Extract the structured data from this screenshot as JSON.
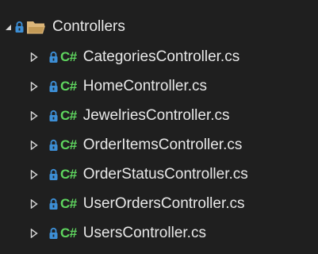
{
  "colors": {
    "background": "#1f1f1f",
    "text": "#e8e8e8",
    "lock_accent": "#3d8fd6",
    "folder_yellow": "#dcb67a",
    "csharp_green": "#5fd65f",
    "expander": "#d4d4d4"
  },
  "folder": {
    "icon": "lock-icon",
    "folder_icon": "folder-open-icon",
    "expander_icon": "expanded-triangle-icon",
    "label": "Controllers"
  },
  "files": [
    {
      "label": "CategoriesController.cs",
      "badge": "C#"
    },
    {
      "label": "HomeController.cs",
      "badge": "C#"
    },
    {
      "label": "JewelriesController.cs",
      "badge": "C#"
    },
    {
      "label": "OrderItemsController.cs",
      "badge": "C#"
    },
    {
      "label": "OrderStatusController.cs",
      "badge": "C#"
    },
    {
      "label": "UserOrdersController.cs",
      "badge": "C#"
    },
    {
      "label": "UsersController.cs",
      "badge": "C#"
    }
  ]
}
